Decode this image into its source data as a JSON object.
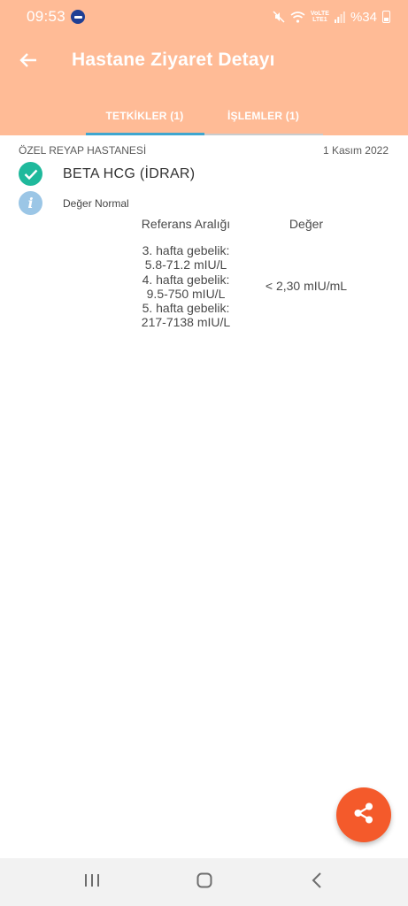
{
  "status_bar": {
    "time": "09:53",
    "volte_line1": "VoLTE",
    "volte_line2": "LTE1",
    "battery": "%34"
  },
  "app_bar": {
    "title": "Hastane Ziyaret Detayı",
    "tabs": [
      {
        "label": "TETKİKLER (1)",
        "active": true
      },
      {
        "label": "İŞLEMLER (1)",
        "active": false
      }
    ]
  },
  "visit": {
    "hospital": "ÖZEL REYAP HASTANESİ",
    "date": "1 Kasım 2022"
  },
  "test": {
    "name": "BETA HCG (İDRAR)",
    "status": "Değer Normal",
    "headers": {
      "reference": "Referans Aralığı",
      "value": "Değer"
    },
    "reference_lines": [
      "3. hafta gebelik:",
      "5.8-71.2 mIU/L",
      "4. hafta gebelik:",
      "9.5-750 mIU/L",
      "5. hafta gebelik:",
      "217-7138 mIU/L"
    ],
    "value": "< 2,30 mIU/mL"
  },
  "icons": {
    "back": "arrow-left-icon",
    "check": "check-circle-icon",
    "info": "info-circle-icon",
    "share": "share-icon",
    "recents": "recents-icon",
    "home": "home-icon",
    "back_nav": "back-chevron-icon"
  },
  "colors": {
    "header": "#ffbb96",
    "tab_indicator": "#3fa6cf",
    "check": "#1fb99c",
    "info": "#9bc6e6",
    "fab": "#f45a2b"
  }
}
